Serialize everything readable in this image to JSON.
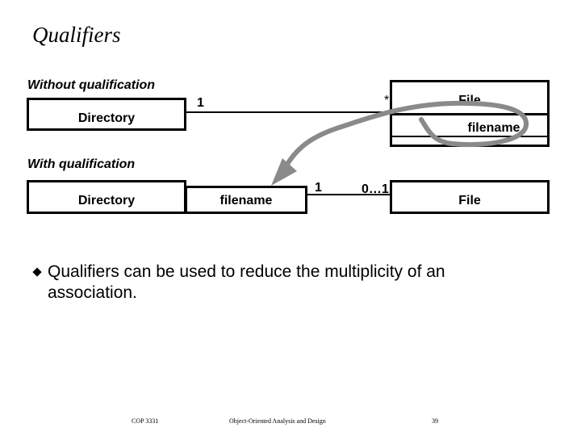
{
  "slide": {
    "title": "Qualifiers",
    "without": {
      "heading": "Without qualification",
      "directory_label": "Directory",
      "file_label": "File",
      "file_attribute": "filename",
      "mult_directory": "1",
      "mult_file": "*"
    },
    "with": {
      "heading": "With qualification",
      "directory_label": "Directory",
      "qualifier_label": "filename",
      "file_label": "File",
      "mult_directory": "1",
      "mult_file": "0…1"
    },
    "bullets": [
      "Qualifiers can be used to reduce the multiplicity of an association."
    ],
    "annotation": {
      "color": "#8a8a8a"
    },
    "footer": {
      "course": "COP 3331",
      "subject": "Object-Oriented Analysis and Design",
      "page": "39"
    }
  }
}
